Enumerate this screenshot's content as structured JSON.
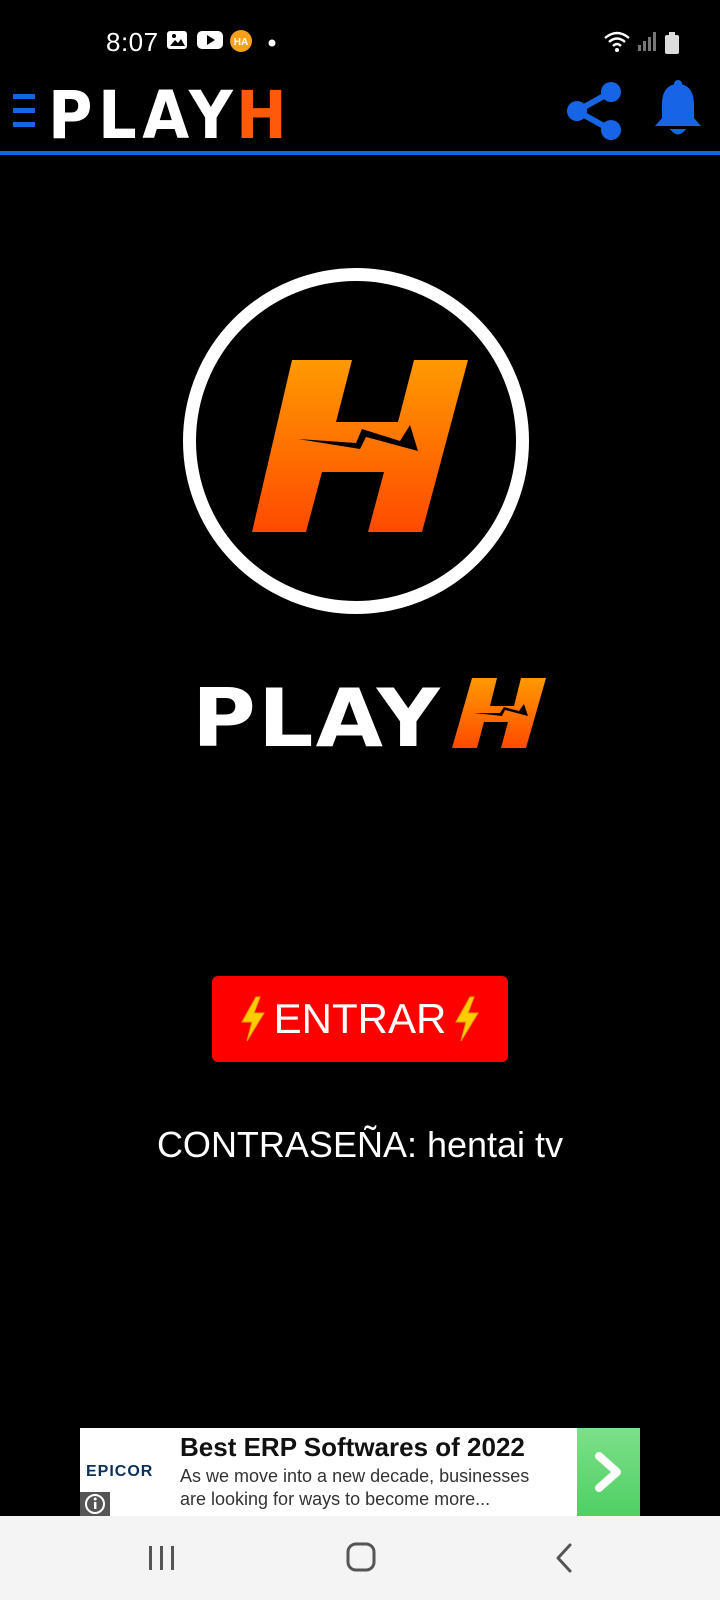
{
  "status_bar": {
    "time": "8:07",
    "icons_left": [
      "gallery-icon",
      "youtube-icon",
      "app-badge-icon",
      "dot-icon"
    ],
    "icons_right": [
      "wifi-icon",
      "signal-icon",
      "battery-icon"
    ]
  },
  "app_bar": {
    "brand_word": "PLAY",
    "brand_letter": "H",
    "accent_color": "#1565e6",
    "icons": [
      "menu-icon",
      "share-icon",
      "bell-icon"
    ]
  },
  "hero": {
    "logo_letter": "H",
    "wordmark_text": "PLAY",
    "wordmark_letter": "H",
    "orange_gradient": [
      "#ff9a00",
      "#ff4a00"
    ]
  },
  "enter_button": {
    "label": "ENTRAR",
    "color": "#ff0000",
    "emoji": "⚡"
  },
  "password_line": "CONTRASEÑA: hentai tv",
  "ad": {
    "brand": "EPICOR",
    "title": "Best ERP Softwares of 2022",
    "body": "As we move into a new decade, businesses are looking for ways to become more..."
  },
  "nav": {
    "icons": [
      "recents-icon",
      "home-icon",
      "back-icon"
    ]
  }
}
